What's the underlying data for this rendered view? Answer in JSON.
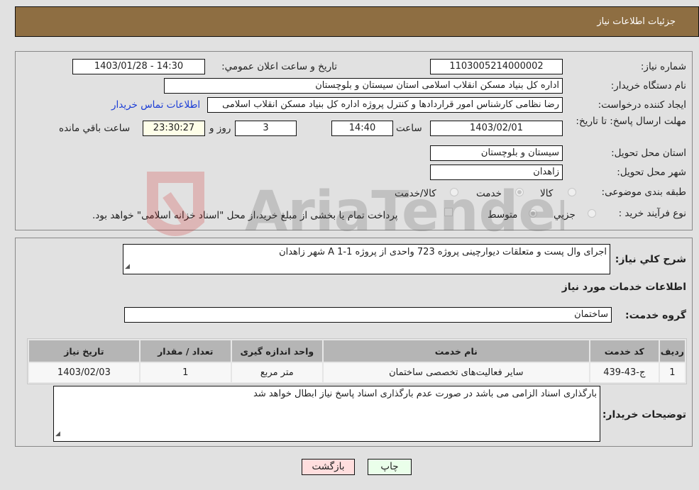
{
  "header": {
    "title": "جزئیات اطلاعات نیاز"
  },
  "fields": {
    "need_number": {
      "label": "شماره نیاز:",
      "value": "1103005214000002"
    },
    "announce_datetime": {
      "label": "تاریخ و ساعت اعلان عمومي:",
      "value": "1403/01/28 - 14:30"
    },
    "buyer_org": {
      "label": "نام دستگاه خریدار:",
      "value": "اداره کل بنیاد مسکن انقلاب اسلامی استان سیستان و بلوچستان"
    },
    "requester": {
      "label": "ایجاد کننده درخواست:",
      "value": "رضا نظامی کارشناس امور قراردادها و کنترل پروژه اداره کل بنیاد مسکن انقلاب اسلامی"
    },
    "contact_link": "اطلاعات تماس خریدار",
    "deadline": {
      "label": "مهلت ارسال پاسخ: تا تاریخ:",
      "date": "1403/02/01",
      "time_label": "ساعت",
      "time": "14:40",
      "days": "3",
      "days_label": "روز و",
      "remaining": "23:30:27",
      "remaining_label": "ساعت باقي مانده"
    },
    "delivery_province": {
      "label": "استان محل تحویل:",
      "value": "سیستان و بلوچستان"
    },
    "delivery_city": {
      "label": "شهر محل تحویل:",
      "value": "زاهدان"
    },
    "category": {
      "label": "طبقه بندی موضوعی:",
      "options": [
        "کالا",
        "خدمت",
        "کالا/خدمت"
      ],
      "selected": "خدمت"
    },
    "purchase_type": {
      "label": "نوع فرآیند خرید :",
      "options": [
        "جزيي",
        "متوسط"
      ],
      "selected": "متوسط",
      "treasury_note": "پرداخت تمام یا بخشی از مبلغ خرید،از محل \"اسناد خزانه اسلامی\" خواهد بود."
    }
  },
  "description": {
    "label": "شرح کلي نياز:",
    "value": "اجرای وال پست و متعلقات دیوارچینی پروژه 723 واحدی از پروژه A 1-1 شهر زاهدان"
  },
  "services_section": {
    "title": "اطلاعات خدمات مورد نیاز"
  },
  "service_group": {
    "label": "گروه خدمت:",
    "value": "ساختمان"
  },
  "table": {
    "headers": [
      "ردیف",
      "کد خدمت",
      "نام خدمت",
      "واحد اندازه گیری",
      "تعداد / مقدار",
      "تاریخ نیاز"
    ],
    "rows": [
      [
        "1",
        "ج-43-439",
        "سایر فعالیت‌های تخصصی ساختمان",
        "متر مربع",
        "1",
        "1403/02/03"
      ]
    ]
  },
  "buyer_notes": {
    "label": "توضیحات خریدار:",
    "value": "بارگذاری اسناد الزامی می باشد در صورت عدم بارگذاری اسناد پاسخ نیاز ابطال خواهد شد"
  },
  "buttons": {
    "print": "چاپ",
    "back": "بازگشت"
  },
  "colors": {
    "header_bg": "#8e6e42",
    "print_bg": "#eaffea",
    "back_bg": "#ffdede",
    "link": "#1a3cd6"
  }
}
